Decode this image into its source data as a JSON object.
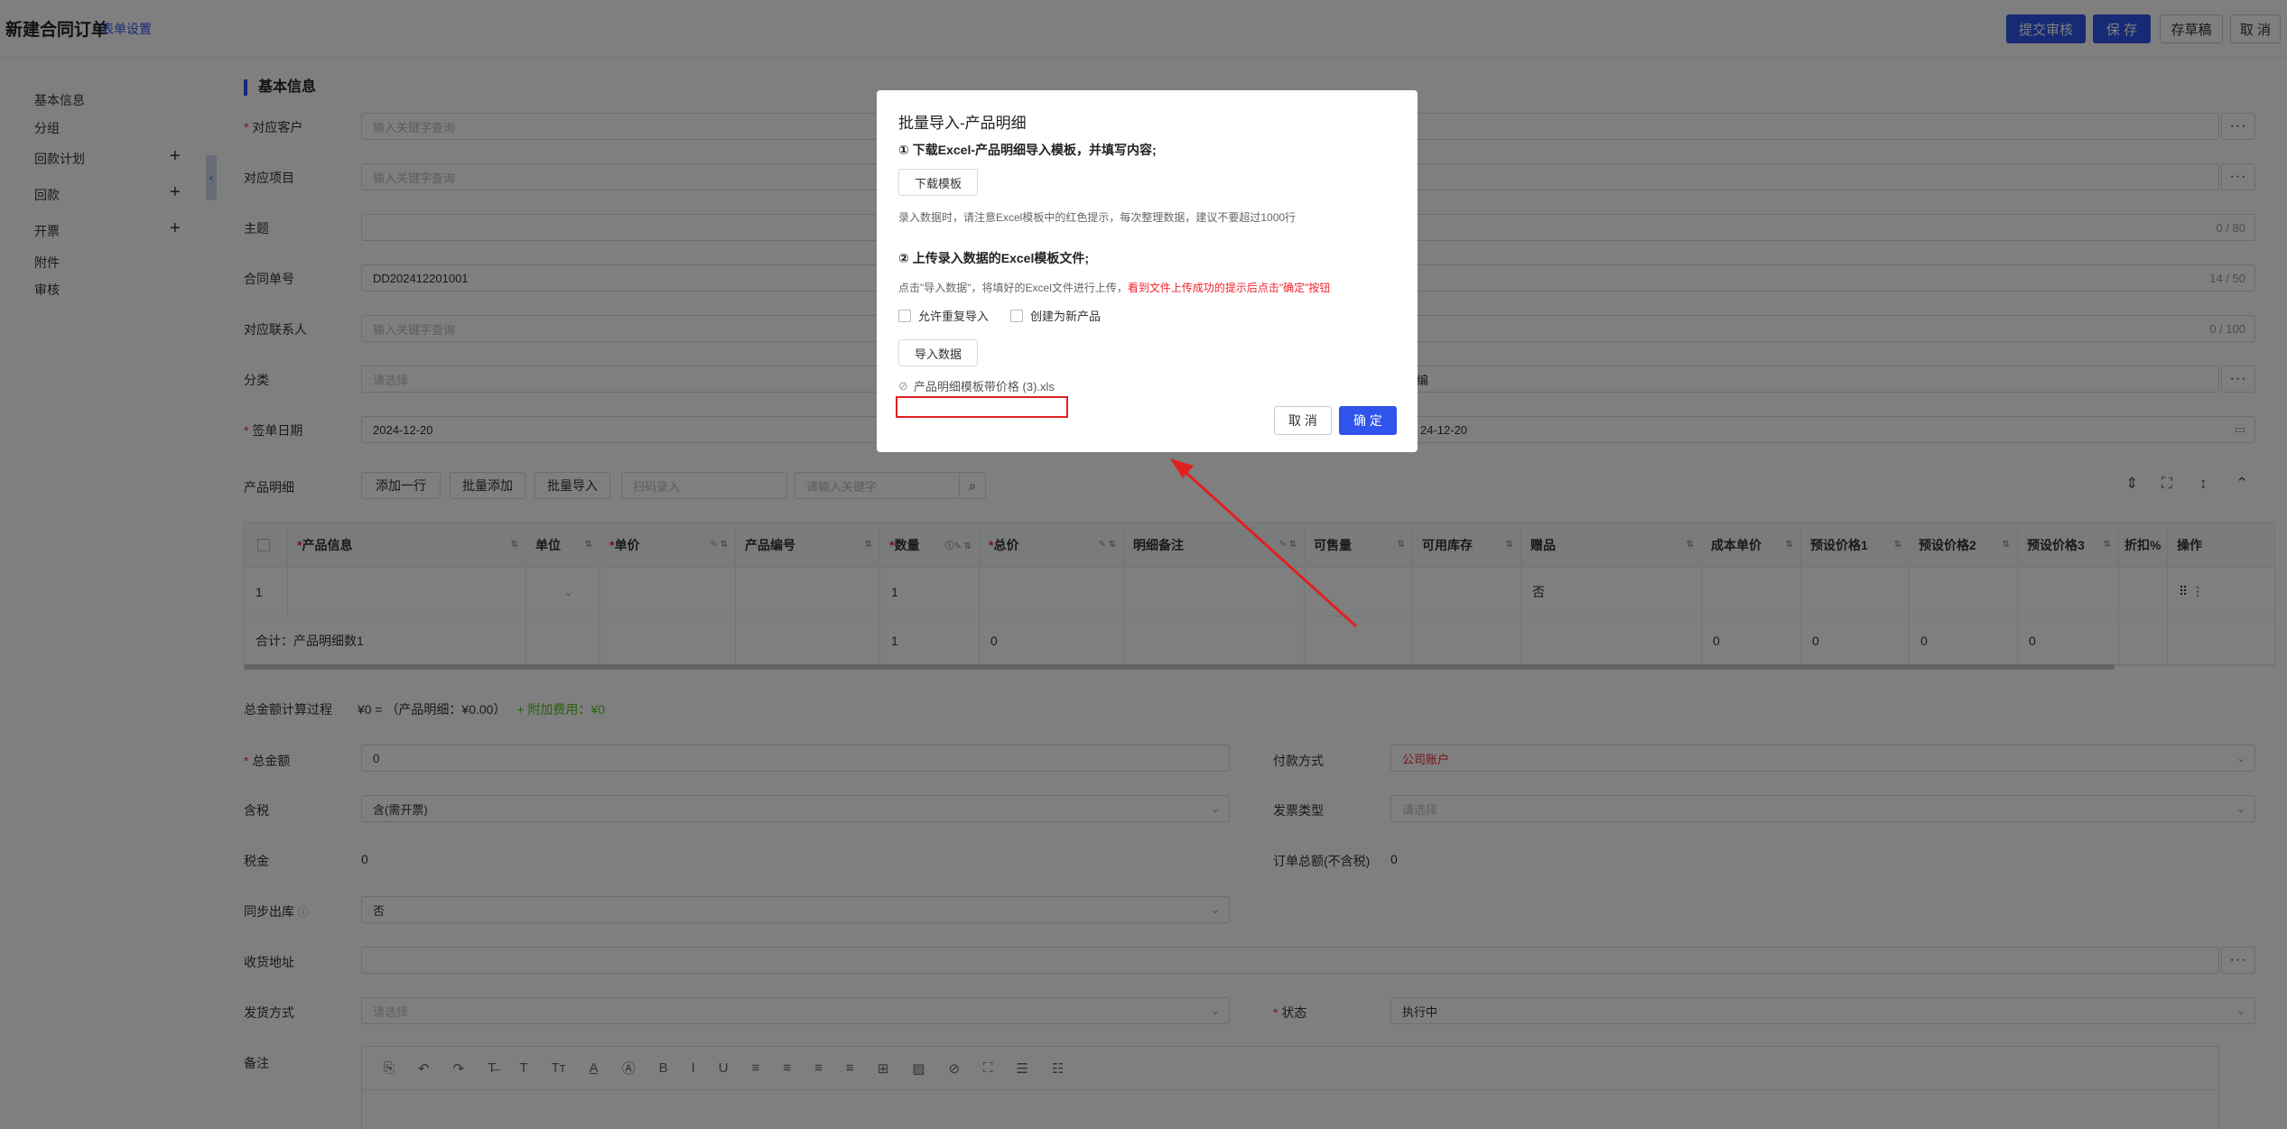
{
  "header": {
    "title": "新建合同订单",
    "form_settings": "表单设置",
    "submit_review": "提交审核",
    "save": "保 存",
    "save_draft": "存草稿",
    "cancel": "取 消"
  },
  "sidebar": {
    "items": [
      "基本信息",
      "分组",
      "回款计划",
      "回款",
      "开票",
      "附件",
      "审核"
    ]
  },
  "section": {
    "title": "基本信息"
  },
  "fields": {
    "customer": {
      "label": "对应客户",
      "placeholder": "输入关键字查询"
    },
    "project": {
      "label": "对应项目",
      "placeholder": "输入关键字查询"
    },
    "subject": {
      "label": "主题",
      "counter": "0 / 80"
    },
    "contract_no": {
      "label": "合同单号",
      "value": "DD202412201001",
      "counter": "14 / 50"
    },
    "contact": {
      "label": "对应联系人",
      "placeholder": "输入关键字查询",
      "counter": "0 / 100"
    },
    "category": {
      "label": "分类",
      "placeholder": "请选择",
      "right_value": "编"
    },
    "sign_date": {
      "label": "签单日期",
      "value": "2024-12-20",
      "right_value": "24-12-20"
    }
  },
  "products": {
    "label": "产品明细",
    "add_row": "添加一行",
    "batch_add": "批量添加",
    "batch_import": "批量导入",
    "barcode_placeholder": "扫码录入",
    "search_placeholder": "请输入关键字",
    "columns": [
      "产品信息",
      "单位",
      "单价",
      "产品编号",
      "数量",
      "总价",
      "明细备注",
      "可售量",
      "可用库存",
      "赠品",
      "成本单价",
      "预设价格1",
      "预设价格2",
      "预设价格3",
      "折扣%",
      "操作"
    ],
    "row": {
      "index": "1",
      "qty": "1",
      "gift": "否"
    },
    "total": {
      "label": "合计：产品明细数1",
      "qty": "1",
      "total_price": "0",
      "cost": "0",
      "p1": "0",
      "p2": "0",
      "p3": "0"
    }
  },
  "amount": {
    "calc_label": "总金额计算过程",
    "calc_value": "¥0 = （产品明细：¥0.00）",
    "calc_extra": "+ 附加费用：¥0",
    "total_label": "总金额",
    "total_value": "0",
    "pay_label": "付款方式",
    "pay_value": "公司账户",
    "tax_label": "含税",
    "tax_value": "含(需开票)",
    "invoice_label": "发票类型",
    "invoice_placeholder": "请选择",
    "taxfee_label": "税金",
    "taxfee_value": "0",
    "order_total_label": "订单总额(不含税)",
    "order_total_value": "0",
    "sync_label": "同步出库",
    "sync_value": "否",
    "address_label": "收货地址",
    "ship_label": "发货方式",
    "ship_placeholder": "请选择",
    "status_label": "状态",
    "status_value": "执行中",
    "remark_label": "备注"
  },
  "dialog": {
    "title": "批量导入-产品明细",
    "step1": "① 下载Excel-产品明细导入模板，并填写内容;",
    "download_btn": "下载模板",
    "hint1": "录入数据时，请注意Excel模板中的红色提示，每次整理数据，建议不要超过1000行",
    "step2": "② 上传录入数据的Excel模板文件;",
    "hint2_prefix": "点击\"导入数据\"，将填好的Excel文件进行上传，",
    "hint2_red": "看到文件上传成功的提示后点击\"确定\"按钮",
    "allow_dup": "允许重复导入",
    "create_new": "创建为新产品",
    "import_btn": "导入数据",
    "file_name": "产品明细模板带价格 (3).xls",
    "cancel": "取 消",
    "ok": "确 定"
  },
  "colors": {
    "primary": "#2f54eb",
    "required": "#f5222d",
    "annotation": "#e02020"
  }
}
